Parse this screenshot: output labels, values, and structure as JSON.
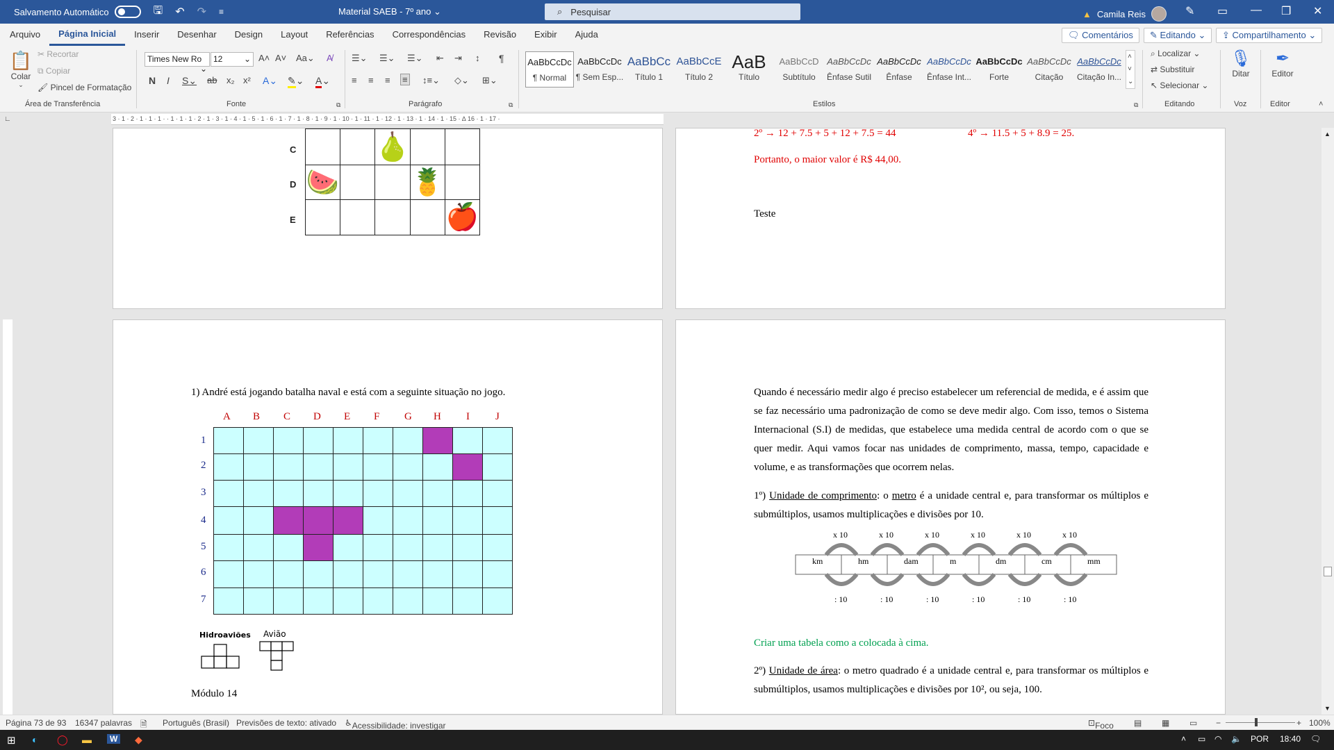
{
  "titlebar": {
    "autosave_label": "Salvamento Automático",
    "doc_title": "Material SAEB - 7º ano",
    "search_placeholder": "Pesquisar",
    "user_name": "Camila Reis"
  },
  "tabs": [
    "Arquivo",
    "Página Inicial",
    "Inserir",
    "Desenhar",
    "Design",
    "Layout",
    "Referências",
    "Correspondências",
    "Revisão",
    "Exibir",
    "Ajuda"
  ],
  "ribbon_right": {
    "comments": "Comentários",
    "editing": "Editando",
    "share": "Compartilhamento"
  },
  "clipboard": {
    "paste": "Colar",
    "cut": "Recortar",
    "copy": "Copiar",
    "format_painter": "Pincel de Formatação",
    "label": "Área de Transferência"
  },
  "font": {
    "name": "Times New Ro",
    "size": "12",
    "label": "Fonte"
  },
  "paragraph": {
    "label": "Parágrafo"
  },
  "styles": {
    "label": "Estilos",
    "items": [
      {
        "preview": "AaBbCcDc",
        "name": "¶ Normal"
      },
      {
        "preview": "AaBbCcDc",
        "name": "¶ Sem Esp..."
      },
      {
        "preview": "AaBbCc",
        "name": "Título 1"
      },
      {
        "preview": "AaBbCcE",
        "name": "Título 2"
      },
      {
        "preview": "AaB",
        "name": "Título"
      },
      {
        "preview": "AaBbCcD",
        "name": "Subtítulo"
      },
      {
        "preview": "AaBbCcDc",
        "name": "Ênfase Sutil"
      },
      {
        "preview": "AaBbCcDc",
        "name": "Ênfase"
      },
      {
        "preview": "AaBbCcDc",
        "name": "Ênfase Int..."
      },
      {
        "preview": "AaBbCcDc",
        "name": "Forte"
      },
      {
        "preview": "AaBbCcDc",
        "name": "Citação"
      },
      {
        "preview": "AaBbCcDc",
        "name": "Citação In..."
      }
    ]
  },
  "editing": {
    "label": "Editando",
    "find": "Localizar",
    "replace": "Substituir",
    "select": "Selecionar"
  },
  "voice": {
    "label": "Voz",
    "dictate": "Ditar"
  },
  "editor": {
    "label": "Editor",
    "btn": "Editor"
  },
  "page1": {
    "rows": [
      "C",
      "D",
      "E"
    ]
  },
  "page2": {
    "line1": "2º → 12 + 7.5 + 5 + 12 + 7.5 = 44",
    "line1b": "4º → 11.5 + 5 + 8.9 = 25.",
    "line2": "Portanto, o maior valor é R$ 44,00.",
    "line3": "Teste"
  },
  "page3": {
    "question": "1) André está jogando batalha naval e está com a seguinte situação no jogo.",
    "cols": [
      "A",
      "B",
      "C",
      "D",
      "E",
      "F",
      "G",
      "H",
      "I",
      "J"
    ],
    "rows": [
      "1",
      "2",
      "3",
      "4",
      "5",
      "6",
      "7"
    ],
    "legend_seaplanes": "Hidroaviões",
    "legend_plane": "Avião",
    "module": "Módulo 14"
  },
  "page4": {
    "intro": "Quando é necessário medir algo é preciso estabelecer um referencial de medida, e é assim que se faz necessário uma padronização de como se deve medir algo. Com isso, temos o Sistema Internacional (S.I) de medidas, que estabelece uma medida central de acordo com o que se quer medir. Aqui vamos focar nas unidades de comprimento, massa, tempo, capacidade e volume, e as transformações que ocorrem nelas.",
    "p1_prefix": "1º)",
    "p1_title": "Unidade de comprimento",
    "p1_colon": ": o",
    "p1_metro": "metro",
    "p1_rest": "é a unidade central e, para transformar os múltiplos e submúltiplos, usamos multiplicações e divisões por 10.",
    "units": [
      "km",
      "hm",
      "dam",
      "m",
      "dm",
      "cm",
      "mm"
    ],
    "mult": "x 10",
    "div": ": 10",
    "green_note": "Criar uma tabela como a colocada à cima.",
    "p2_prefix": "2º)",
    "p2_title": "Unidade de área",
    "p2_rest": ": o metro quadrado é a unidade central e, para transformar os múltiplos e submúltiplos, usamos multiplicações e divisões por 10², ou seja, 100."
  },
  "status": {
    "page": "Página 73 de 93",
    "words": "16347 palavras",
    "lang": "Português (Brasil)",
    "predictions": "Previsões de texto: ativado",
    "accessibility": "Acessibilidade: investigar",
    "focus": "Foco",
    "zoom": "100%"
  },
  "taskbar": {
    "lang": "POR",
    "time": "18:40"
  }
}
